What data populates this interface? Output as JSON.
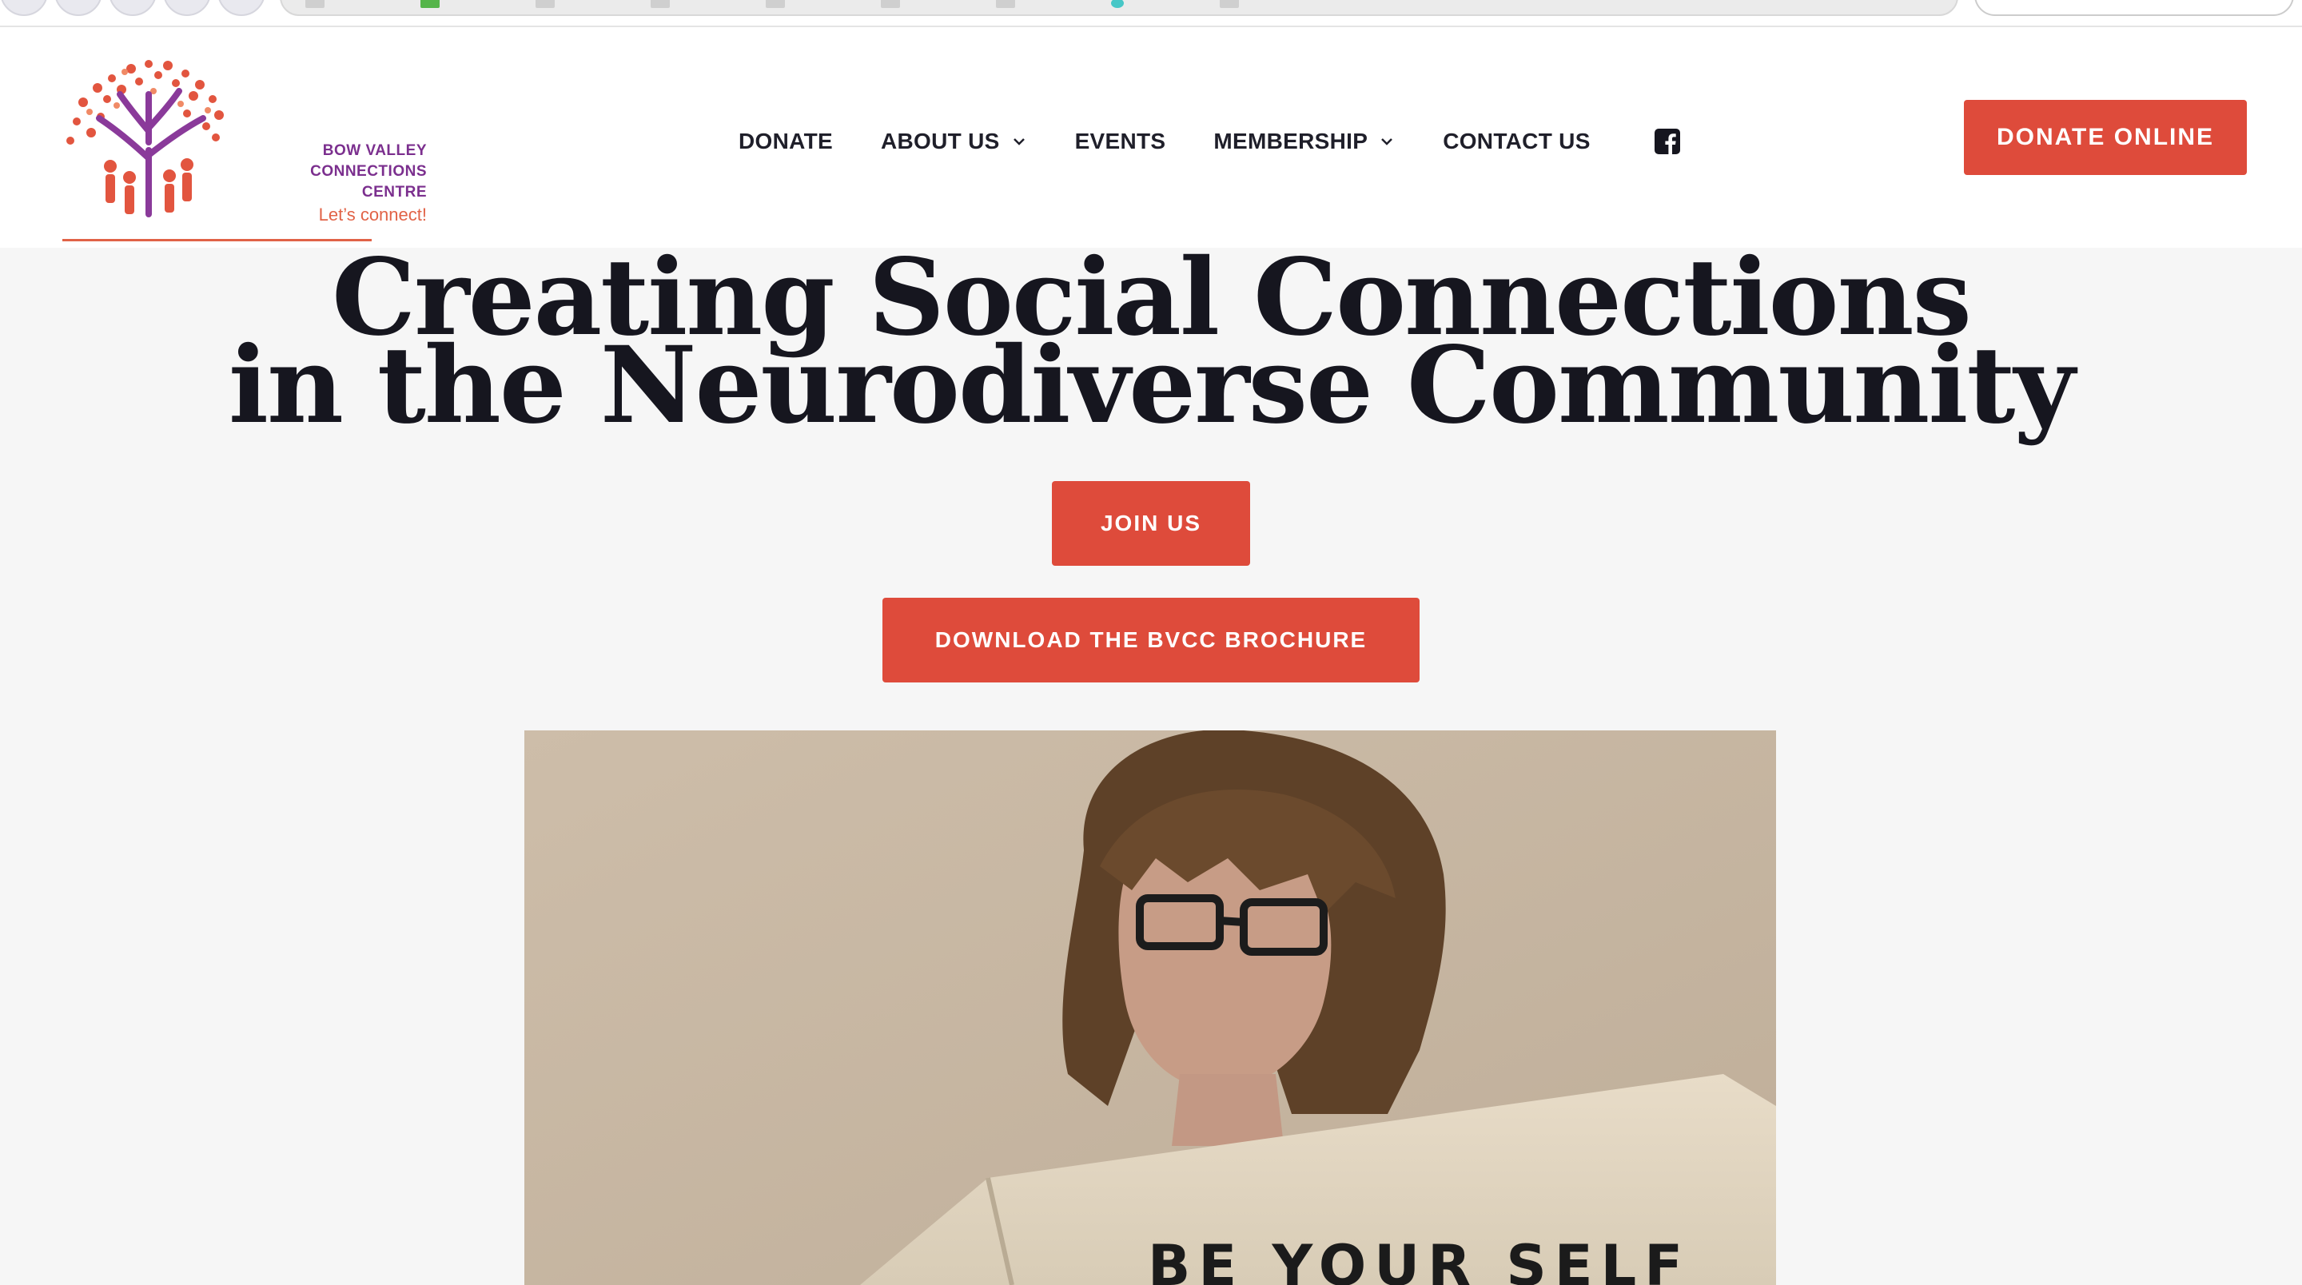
{
  "logo": {
    "name_line1": "BOW VALLEY",
    "name_line2": "CONNECTIONS",
    "name_line3": "CENTRE",
    "tagline": "Let’s connect!",
    "icon": "tree-with-people-icon"
  },
  "nav": {
    "items": [
      {
        "label": "DONATE",
        "has_dropdown": false
      },
      {
        "label": "ABOUT US",
        "has_dropdown": true
      },
      {
        "label": "EVENTS",
        "has_dropdown": false
      },
      {
        "label": "MEMBERSHIP",
        "has_dropdown": true
      },
      {
        "label": "CONTACT US",
        "has_dropdown": false
      }
    ],
    "social_icon": "facebook-icon"
  },
  "header": {
    "donate_online_label": "DONATE ONLINE"
  },
  "hero": {
    "title_line1": "Creating Social Connections",
    "title_line2": "in the Neurodiverse Community",
    "join_label": "JOIN US",
    "brochure_label": "DOWNLOAD THE BVCC BROCHURE",
    "photo_sign_text": "BE YOUR SELF"
  },
  "colors": {
    "accent": "#de4b3b",
    "brand_purple": "#7b2f8e",
    "text_dark": "#16161f",
    "page_bg": "#f6f6f6"
  }
}
